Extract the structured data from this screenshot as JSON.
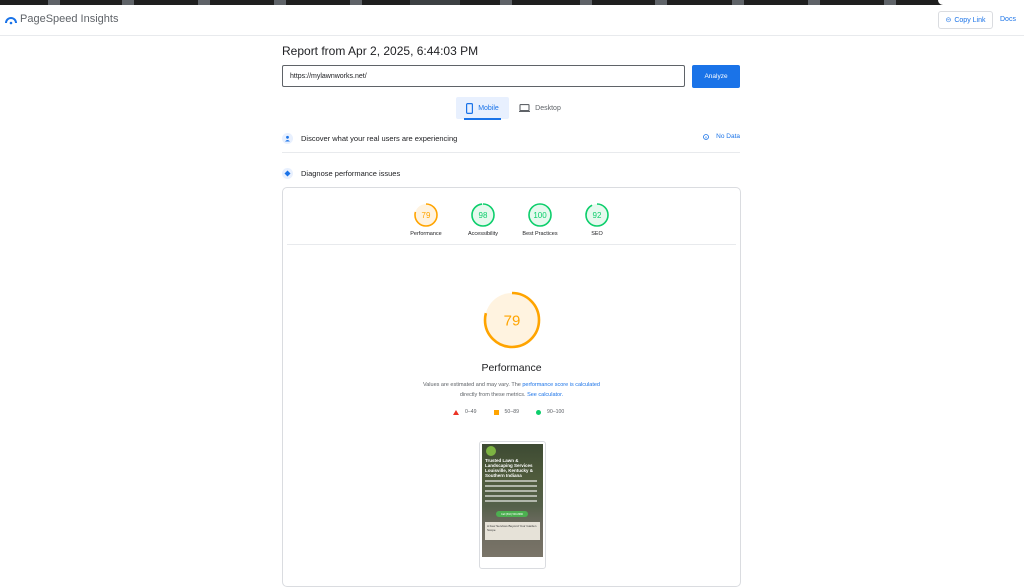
{
  "brand": {
    "name": "PageSpeed Insights"
  },
  "header": {
    "copy_link": "Copy Link",
    "docs": "Docs"
  },
  "report": {
    "title": "Report from Apr 2, 2025, 6:44:03 PM"
  },
  "url_input": {
    "value": "https://mylawnworks.net/"
  },
  "analyze": {
    "label": "Analyze"
  },
  "device_tabs": {
    "mobile": "Mobile",
    "desktop": "Desktop",
    "selected": "Mobile"
  },
  "real_users": {
    "title": "Discover what your real users are experiencing",
    "status": "No Data"
  },
  "diagnose": {
    "title": "Diagnose performance issues"
  },
  "scores": [
    {
      "label": "Performance",
      "value": 79,
      "color": "#ffa400"
    },
    {
      "label": "Accessibility",
      "value": 98,
      "color": "#0cce6b"
    },
    {
      "label": "Best Practices",
      "value": 100,
      "color": "#0cce6b"
    },
    {
      "label": "SEO",
      "value": 92,
      "color": "#0cce6b"
    }
  ],
  "performance": {
    "title": "Performance",
    "score": 79,
    "color": "#ffa400",
    "note_1": "Values are estimated and may vary. The ",
    "note_link_1": "performance score is calculated",
    "note_2": "directly from these metrics. ",
    "note_link_2": "See calculator."
  },
  "legend": {
    "low": "0–49",
    "mid": "50–89",
    "high": "90–100"
  },
  "screenshot": {
    "heading": "Trusted Lawn & Landscaping Services Louisville, Kentucky & Southern Indiana",
    "button": "Call (502) 500-8990",
    "box_text": "A Few Services Beyond Your Garden Scope"
  }
}
